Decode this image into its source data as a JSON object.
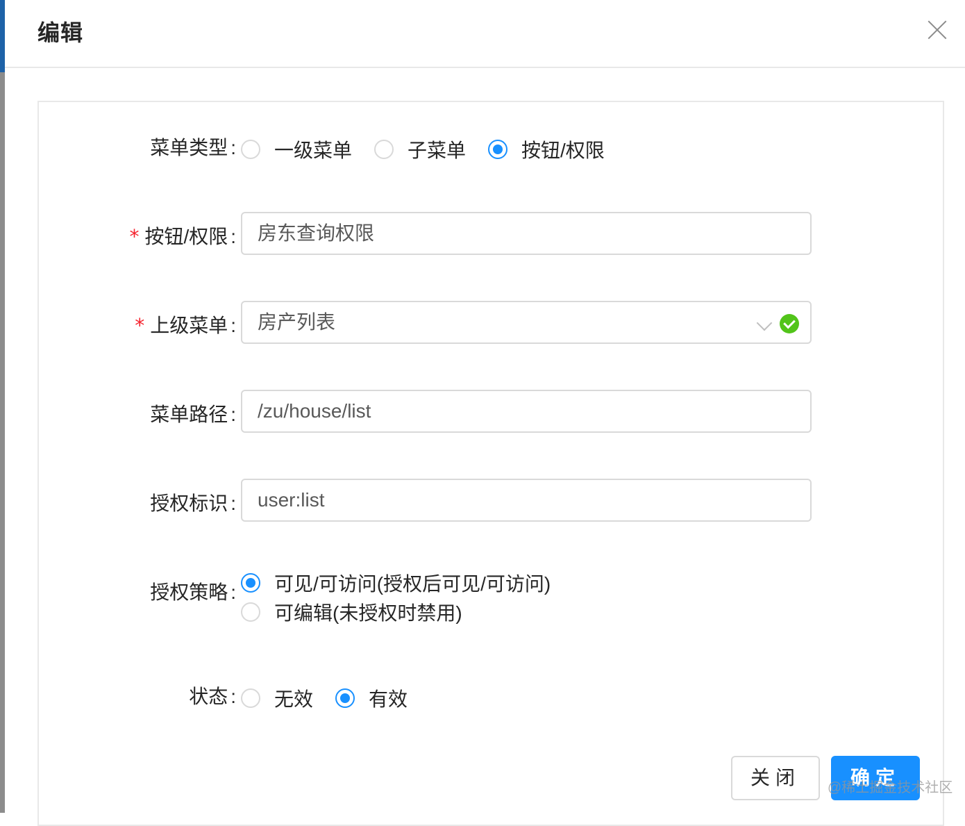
{
  "modal": {
    "title": "编辑"
  },
  "form": {
    "menu_type": {
      "label": "菜单类型",
      "options": [
        "一级菜单",
        "子菜单",
        "按钮/权限"
      ],
      "selected": "按钮/权限"
    },
    "button_permission": {
      "label": "按钮/权限",
      "required_mark": "*",
      "value": "房东查询权限"
    },
    "parent_menu": {
      "label": "上级菜单",
      "required_mark": "*",
      "value": "房产列表"
    },
    "menu_path": {
      "label": "菜单路径",
      "value": "/zu/house/list"
    },
    "auth_identifier": {
      "label": "授权标识",
      "value": "user:list"
    },
    "auth_strategy": {
      "label": "授权策略",
      "options": [
        "可见/可访问(授权后可见/可访问)",
        "可编辑(未授权时禁用)"
      ],
      "selected": "可见/可访问(授权后可见/可访问)"
    },
    "status": {
      "label": "状态",
      "options": [
        "无效",
        "有效"
      ],
      "selected": "有效"
    }
  },
  "footer": {
    "close_label": "关闭",
    "ok_label": "确定"
  },
  "watermark": "@稀土掘金技术社区",
  "colors": {
    "primary": "#1890ff",
    "success": "#52c41a",
    "required": "#f5222d"
  }
}
